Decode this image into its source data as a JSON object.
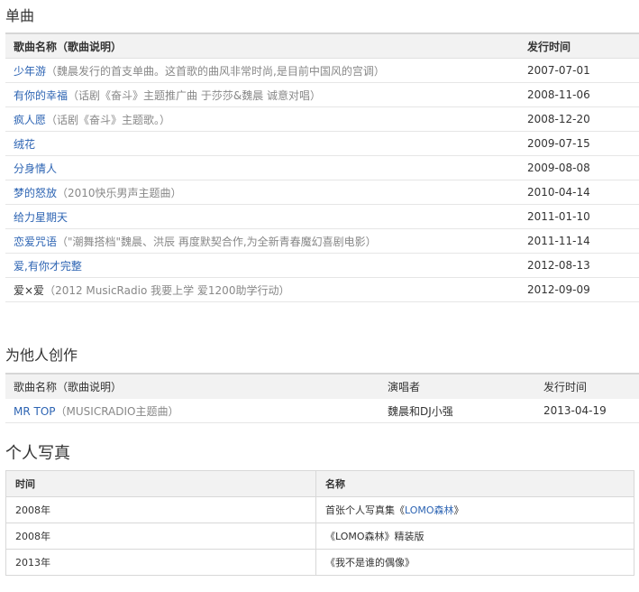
{
  "singles": {
    "title": "单曲",
    "headers": {
      "name": "歌曲名称（歌曲说明）",
      "date": "发行时间"
    },
    "rows": [
      {
        "name": "少年游",
        "desc": "（魏晨发行的首支单曲。这首歌的曲风非常时尚,是目前中国风的宫调）",
        "date": "2007-07-01",
        "link": true
      },
      {
        "name": "有你的幸福",
        "desc": "（话剧《奋斗》主题推广曲 于莎莎&魏晨 诚意对唱）",
        "date": "2008-11-06",
        "link": true
      },
      {
        "name": "疯人愿",
        "desc": "（话剧《奋斗》主题歌。）",
        "date": "2008-12-20",
        "link": true
      },
      {
        "name": "绒花",
        "desc": "",
        "date": "2009-07-15",
        "link": true
      },
      {
        "name": "分身情人",
        "desc": "",
        "date": "2009-08-08",
        "link": true
      },
      {
        "name": "梦的怒放",
        "desc": "（2010快乐男声主题曲）",
        "date": "2010-04-14",
        "link": true
      },
      {
        "name": "给力星期天",
        "desc": "",
        "date": "2011-01-10",
        "link": true
      },
      {
        "name": "恋爱咒语",
        "desc": "（\"潮舞搭档\"魏晨、洪辰 再度默契合作,为全新青春魔幻喜剧电影）",
        "date": "2011-11-14",
        "link": true
      },
      {
        "name": "爱,有你才完整",
        "desc": "",
        "date": "2012-08-13",
        "link": true
      },
      {
        "name": "爱×爱",
        "desc": "（2012 MusicRadio 我要上学 爱1200助学行动）",
        "date": "2012-09-09",
        "link": false
      }
    ]
  },
  "others": {
    "title": "为他人创作",
    "headers": {
      "name": "歌曲名称（歌曲说明）",
      "singer": "演唱者",
      "date": "发行时间"
    },
    "rows": [
      {
        "name": "MR TOP",
        "desc": "（MUSICRADIO主题曲）",
        "singer": "魏晨和DJ小强",
        "date": "2013-04-19"
      }
    ]
  },
  "photobook": {
    "title": "个人写真",
    "headers": {
      "time": "时间",
      "name": "名称"
    },
    "rows": [
      {
        "time": "2008年",
        "pre": "首张个人写真集《",
        "link": "LOMO森林",
        "post": "》"
      },
      {
        "time": "2008年",
        "pre": "《LOMO森林》精装版",
        "link": "",
        "post": ""
      },
      {
        "time": "2013年",
        "pre": "《我不是谁的偶像》",
        "link": "",
        "post": ""
      }
    ]
  }
}
